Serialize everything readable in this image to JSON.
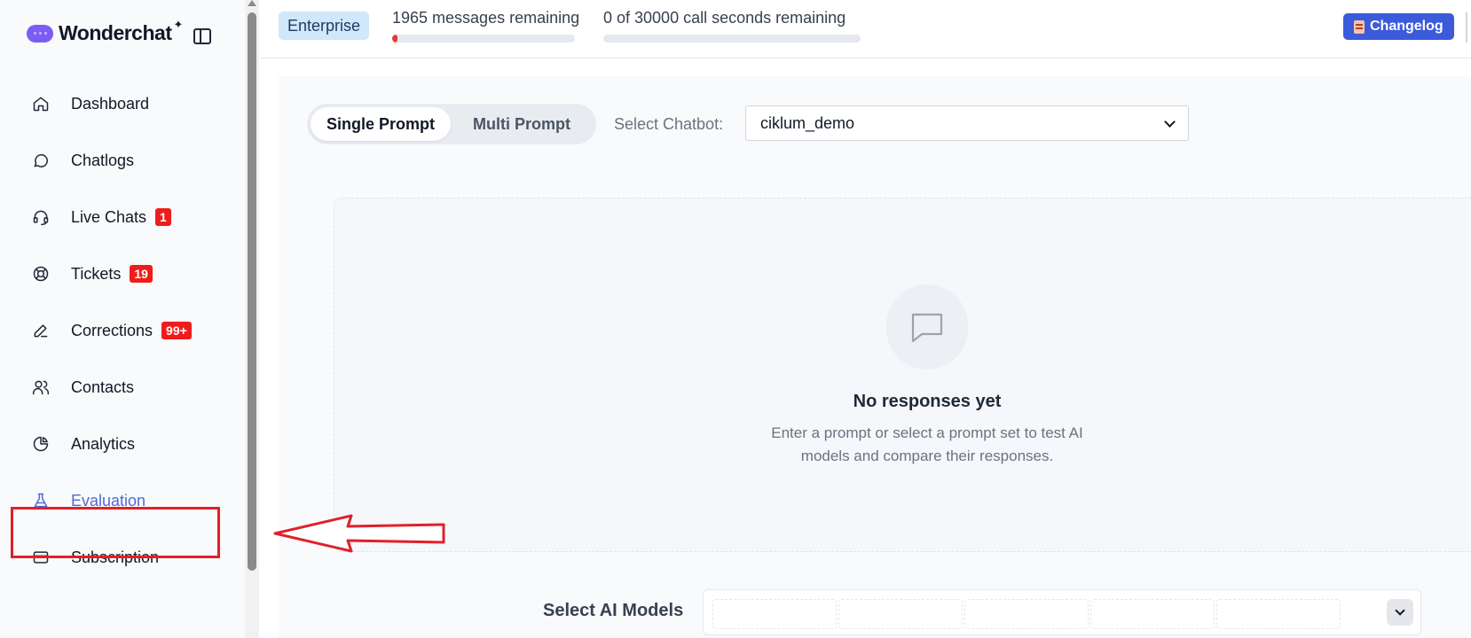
{
  "app": {
    "name": "Wonderchat",
    "star": "✦"
  },
  "sidebar": {
    "items": [
      {
        "label": "Dashboard",
        "icon": "home-icon",
        "badge": ""
      },
      {
        "label": "Chatlogs",
        "icon": "chat-bubble-icon",
        "badge": ""
      },
      {
        "label": "Live Chats",
        "icon": "headset-icon",
        "badge": "1"
      },
      {
        "label": "Tickets",
        "icon": "lifebuoy-icon",
        "badge": "19"
      },
      {
        "label": "Corrections",
        "icon": "pen-icon",
        "badge": "99+"
      },
      {
        "label": "Contacts",
        "icon": "users-icon",
        "badge": ""
      },
      {
        "label": "Analytics",
        "icon": "pie-chart-icon",
        "badge": ""
      },
      {
        "label": "Evaluation",
        "icon": "flask-icon",
        "badge": "",
        "active": true
      },
      {
        "label": "Subscription",
        "icon": "credit-card-icon",
        "badge": ""
      }
    ]
  },
  "topbar": {
    "plan": "Enterprise",
    "messages_remaining": "1965 messages remaining",
    "messages_fraction_used": 0.02,
    "call_seconds_remaining": "0 of 30000 call seconds remaining",
    "call_fraction_used": 0,
    "changelog_label": "Changelog"
  },
  "main": {
    "modes": [
      "Single Prompt",
      "Multi Prompt"
    ],
    "selected_mode": "Single Prompt",
    "chatbot_label": "Select Chatbot:",
    "chatbot_value": "ciklum_demo",
    "empty_title": "No responses yet",
    "empty_desc": "Enter a prompt or select a prompt set to test AI models and compare their responses.",
    "models_label": "Select AI Models"
  },
  "colors": {
    "accent": "#4f6bd6",
    "badge": "#ef1c1c",
    "annotation": "#e0202a",
    "changelog": "#3b5bdb"
  }
}
